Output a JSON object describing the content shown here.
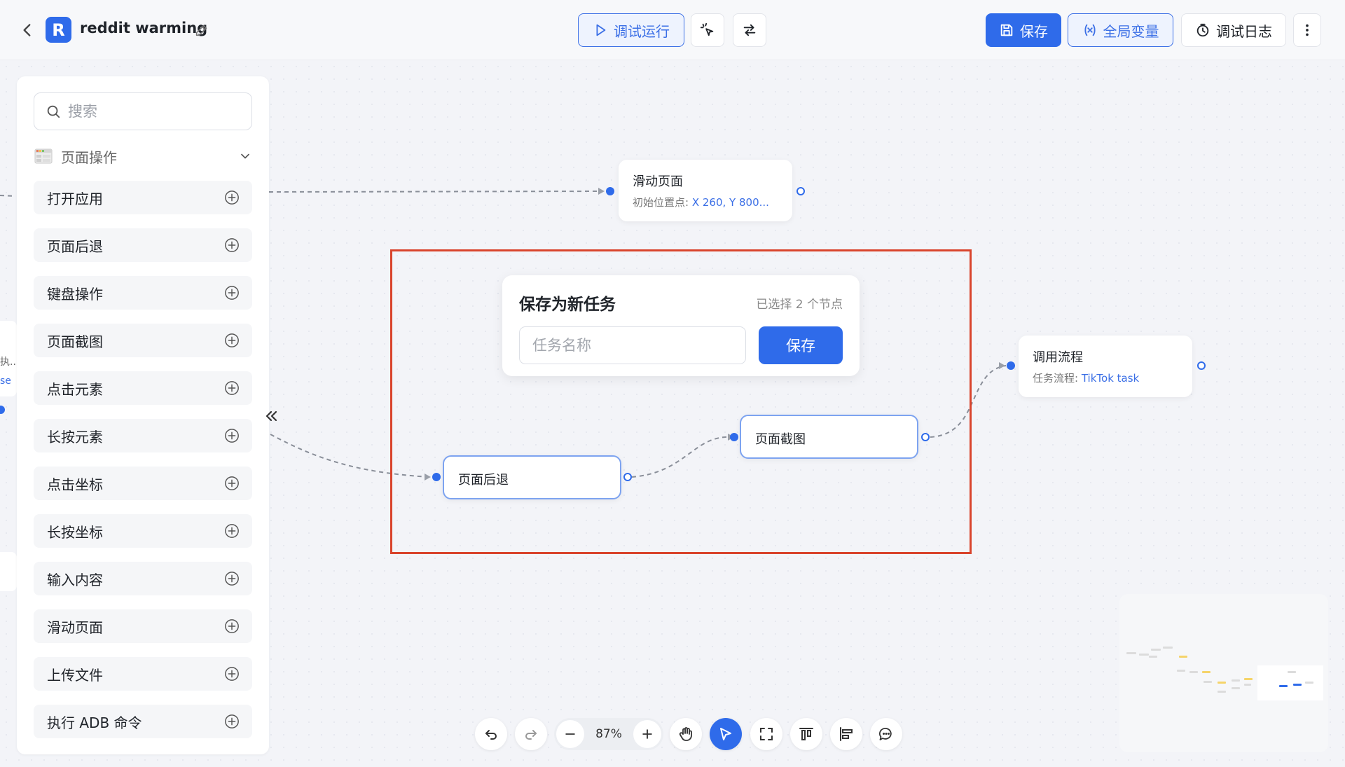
{
  "header": {
    "app_initial": "R",
    "title": "reddit warming",
    "debug_run_label": "调试运行",
    "save_label": "保存",
    "global_vars_label": "全局变量",
    "debug_log_label": "调试日志"
  },
  "sidebar": {
    "search_placeholder": "搜索",
    "section_label": "页面操作",
    "items": [
      {
        "label": "打开应用"
      },
      {
        "label": "页面后退"
      },
      {
        "label": "键盘操作"
      },
      {
        "label": "页面截图"
      },
      {
        "label": "点击元素"
      },
      {
        "label": "长按元素"
      },
      {
        "label": "点击坐标"
      },
      {
        "label": "长按坐标"
      },
      {
        "label": "输入内容"
      },
      {
        "label": "滑动页面"
      },
      {
        "label": "上传文件"
      },
      {
        "label": "执行 ADB 命令"
      }
    ]
  },
  "nodes": {
    "scroll": {
      "title": "滑动页面",
      "sub_label": "初始位置点:",
      "sub_value": "X 260, Y 800..."
    },
    "call_flow": {
      "title": "调用流程",
      "sub_label": "任务流程:",
      "sub_value": "TikTok task"
    },
    "back": {
      "title": "页面后退"
    },
    "screenshot": {
      "title": "页面截图"
    },
    "partial_left": {
      "text1": "执...",
      "text2": "se"
    }
  },
  "save_card": {
    "title": "保存为新任务",
    "selected_count": "已选择 2 个节点",
    "name_placeholder": "任务名称",
    "save_label": "保存"
  },
  "toolbar": {
    "zoom_value": "87%"
  },
  "colors": {
    "accent": "#2f6bea",
    "selection_border": "#d9442c"
  }
}
